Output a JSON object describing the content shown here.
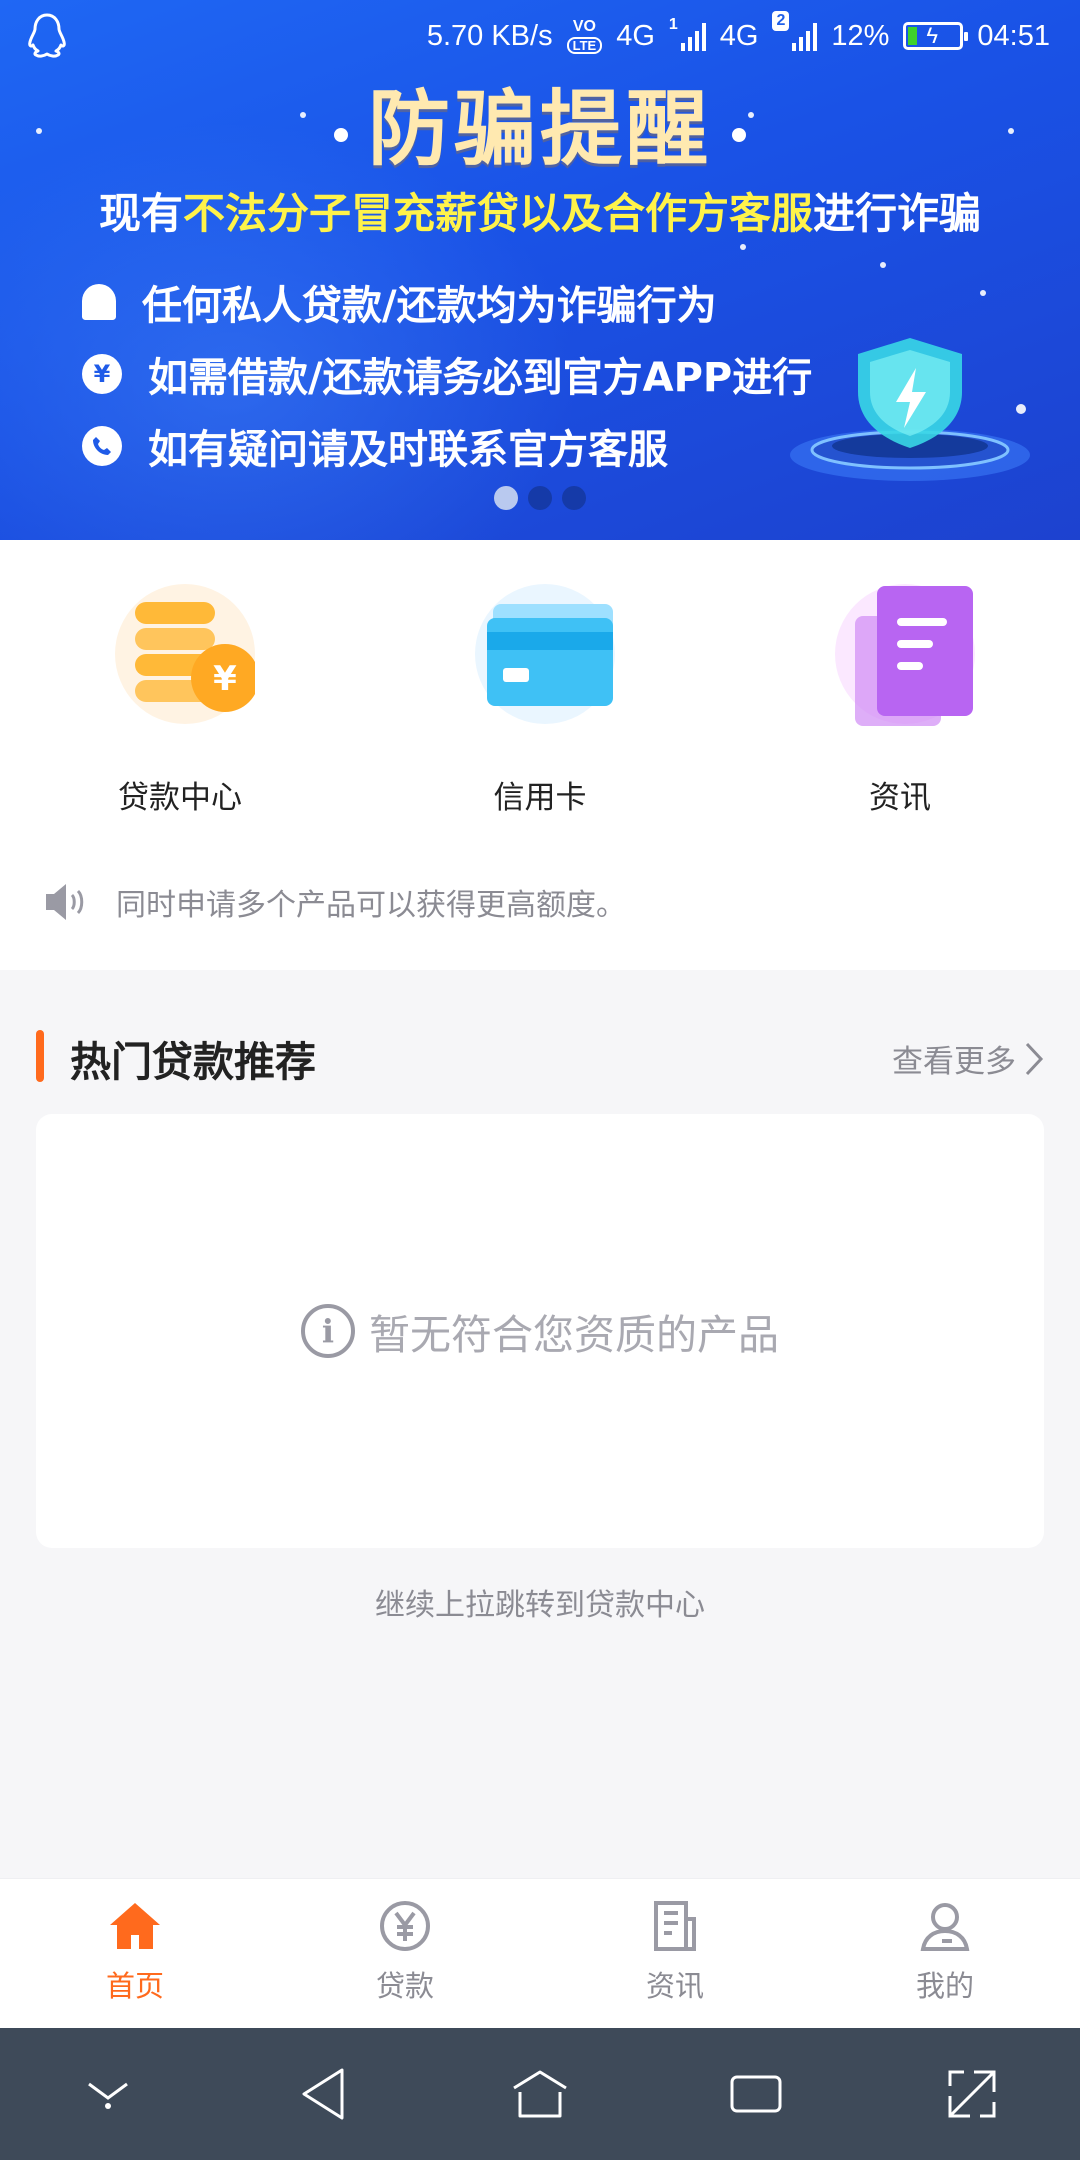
{
  "status_bar": {
    "speed": "5.70 KB/s",
    "volte": "VO",
    "lte": "LTE",
    "net1": "4G",
    "sim1": "1",
    "net2": "4G",
    "sim2": "2",
    "battery": "12%",
    "time": "04:51"
  },
  "banner": {
    "headline": "防骗提醒",
    "subline_prefix": "现有",
    "subline_highlight": "不法分子冒充薪贷以及合作方客服",
    "subline_suffix": "进行诈骗",
    "bullets": [
      {
        "icon": "bell-icon",
        "text": "任何私人贷款/还款均为诈骗行为"
      },
      {
        "icon": "yen-icon",
        "symbol": "¥",
        "text": "如需借款/还款请务必到官方APP进行"
      },
      {
        "icon": "phone-icon",
        "text": "如有疑问请及时联系官方客服"
      }
    ],
    "page_count": 3,
    "active_page": 0
  },
  "entries": [
    {
      "icon": "loan-coins-icon",
      "label": "贷款中心"
    },
    {
      "icon": "credit-card-icon",
      "label": "信用卡"
    },
    {
      "icon": "news-document-icon",
      "label": "资讯"
    }
  ],
  "notice": {
    "icon": "speaker-icon",
    "text": "同时申请多个产品可以获得更高额度。"
  },
  "hot": {
    "title": "热门贷款推荐",
    "more": "查看更多",
    "empty_icon_text": "i",
    "empty_message": "暂无符合您资质的产品",
    "pull_hint": "继续上拉跳转到贷款中心"
  },
  "tabbar": [
    {
      "icon": "home-icon",
      "label": "首页",
      "active": true
    },
    {
      "icon": "yen-circle-icon",
      "label": "贷款",
      "active": false
    },
    {
      "icon": "news-icon",
      "label": "资讯",
      "active": false
    },
    {
      "icon": "user-icon",
      "label": "我的",
      "active": false
    }
  ],
  "colors": {
    "accent": "#ff6a1d",
    "banner_blue": "#1f67f4",
    "highlight_yellow": "#fff34a",
    "nav_bar": "#3e4a59"
  }
}
